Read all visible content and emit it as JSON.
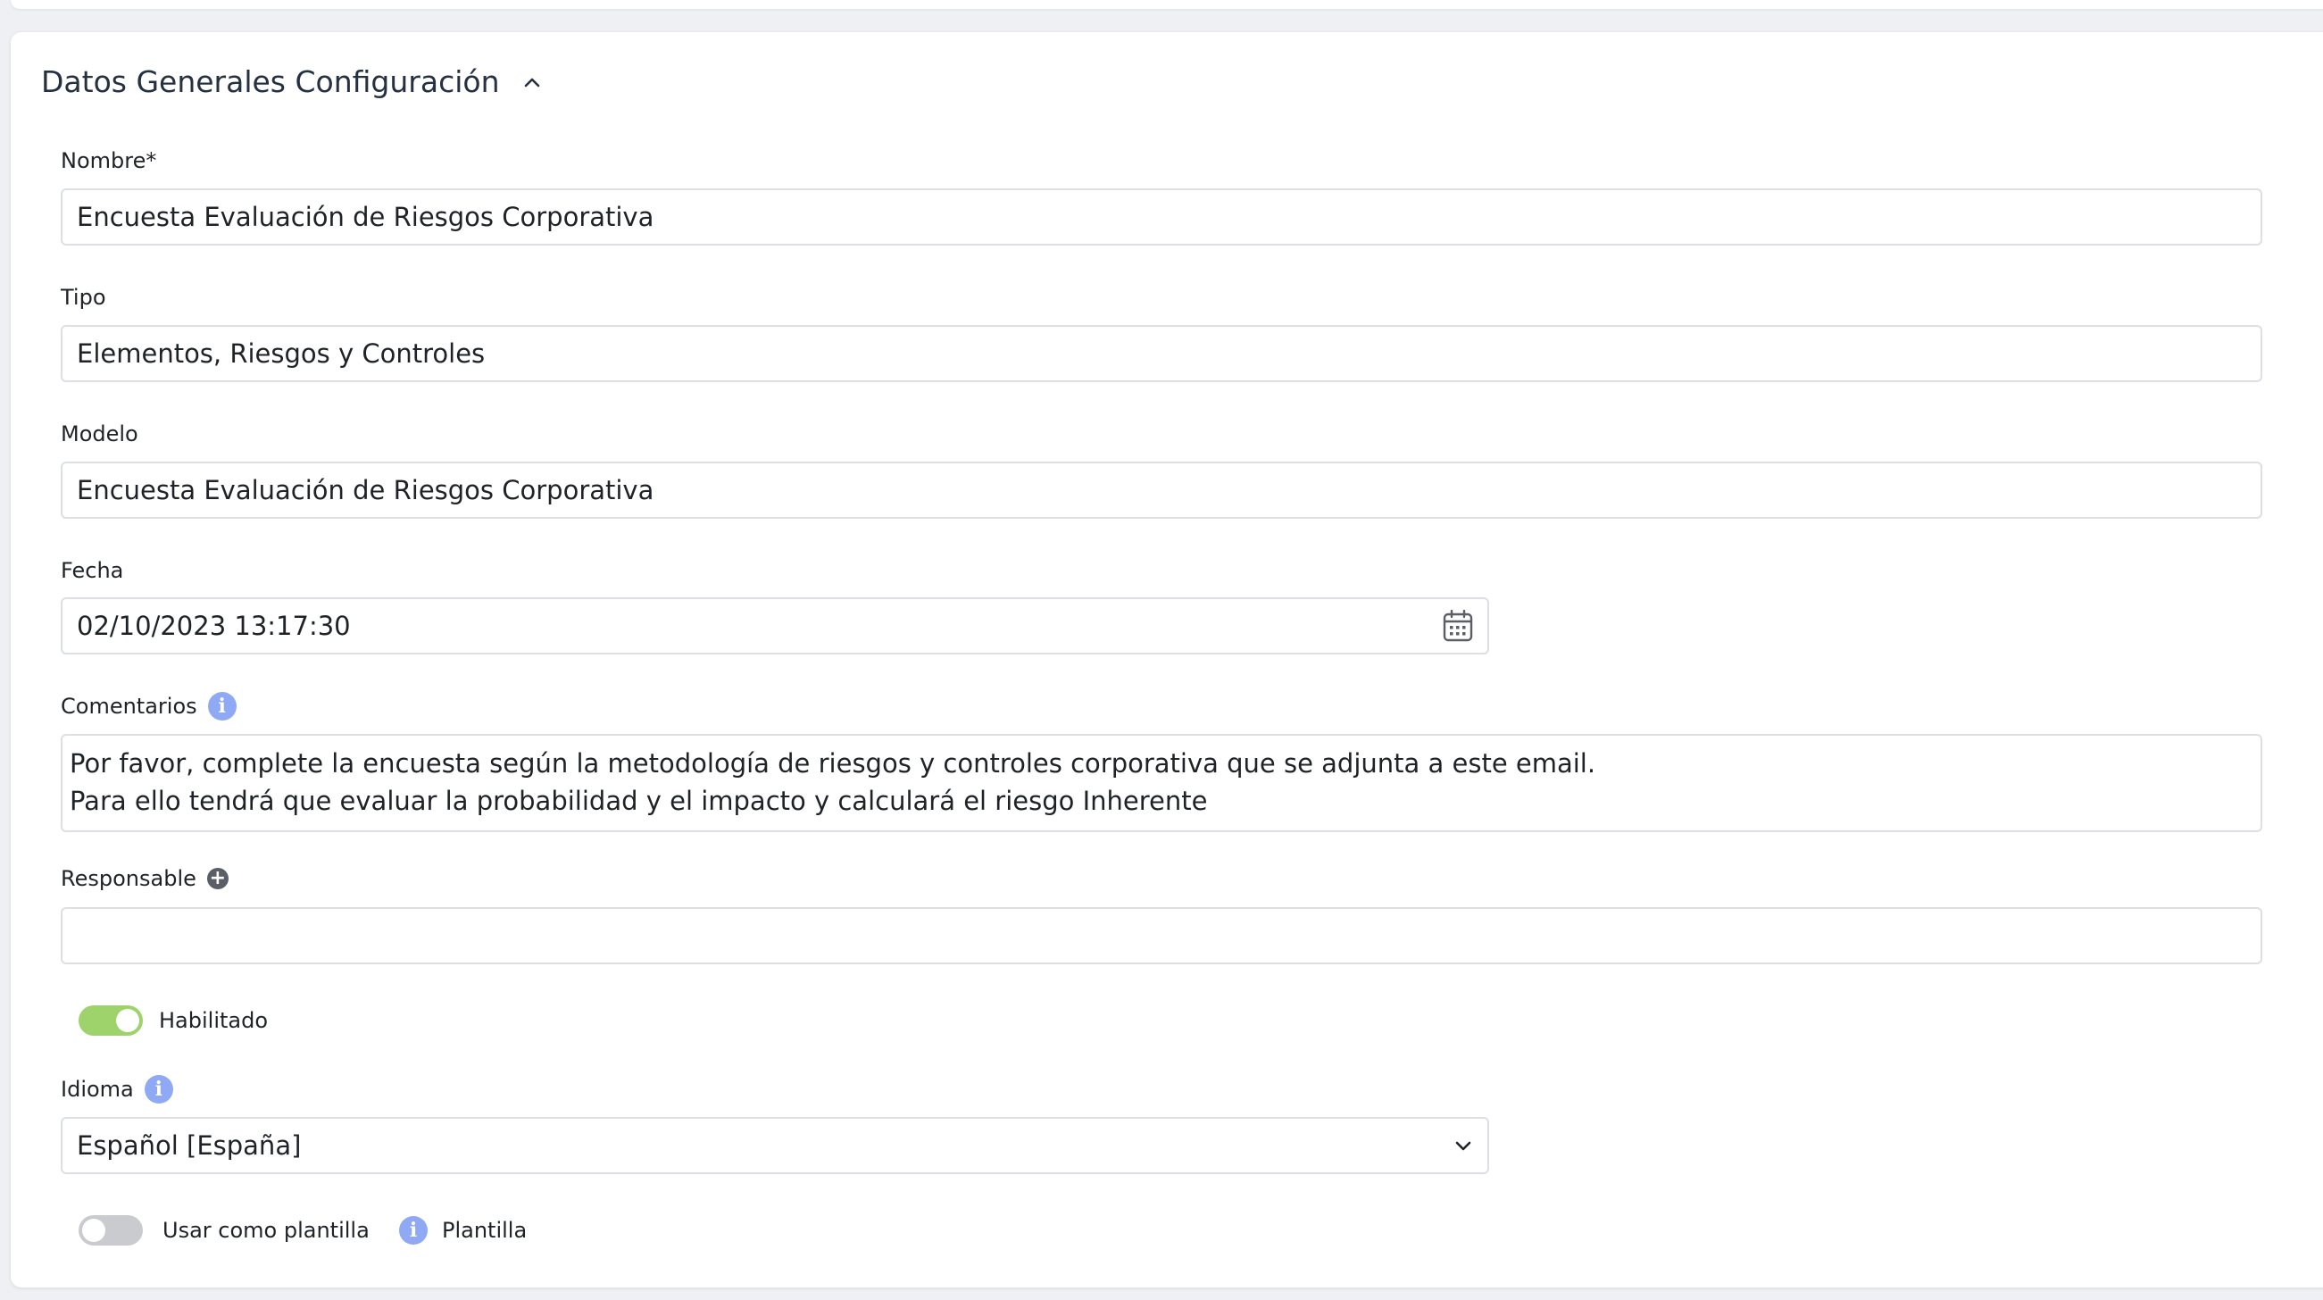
{
  "section": {
    "title": "Datos Generales Configuración"
  },
  "fields": {
    "nombre": {
      "label": "Nombre*",
      "value": "Encuesta Evaluación de Riesgos Corporativa"
    },
    "tipo": {
      "label": "Tipo",
      "value": "Elementos, Riesgos y Controles"
    },
    "modelo": {
      "label": "Modelo",
      "value": "Encuesta Evaluación de Riesgos Corporativa"
    },
    "fecha": {
      "label": "Fecha",
      "value": "02/10/2023 13:17:30"
    },
    "comentarios": {
      "label": "Comentarios",
      "line1": "Por favor, complete la encuesta según la metodología de riesgos y controles corporativa que se adjunta a este email.",
      "line2": "Para ello tendrá que evaluar la probabilidad y el impacto y calculará el riesgo Inherente"
    },
    "responsable": {
      "label": "Responsable",
      "value": ""
    },
    "habilitado": {
      "label": "Habilitado",
      "checked": true
    },
    "idioma": {
      "label": "Idioma",
      "value": "Español [España]"
    },
    "plantilla": {
      "toggle_label": "Usar como plantilla",
      "checked": false,
      "info_label": "Plantilla"
    }
  },
  "icons": {
    "info": "info-icon",
    "calendar": "calendar-icon",
    "chevron_up": "chevron-up-icon",
    "chevron_down": "chevron-down-icon",
    "add": "plus-circle-icon"
  },
  "colors": {
    "toggle_on": "#9ed26a",
    "toggle_off": "#c9cbcf",
    "info": "#8fa9f5",
    "border": "#dcdfe4"
  }
}
